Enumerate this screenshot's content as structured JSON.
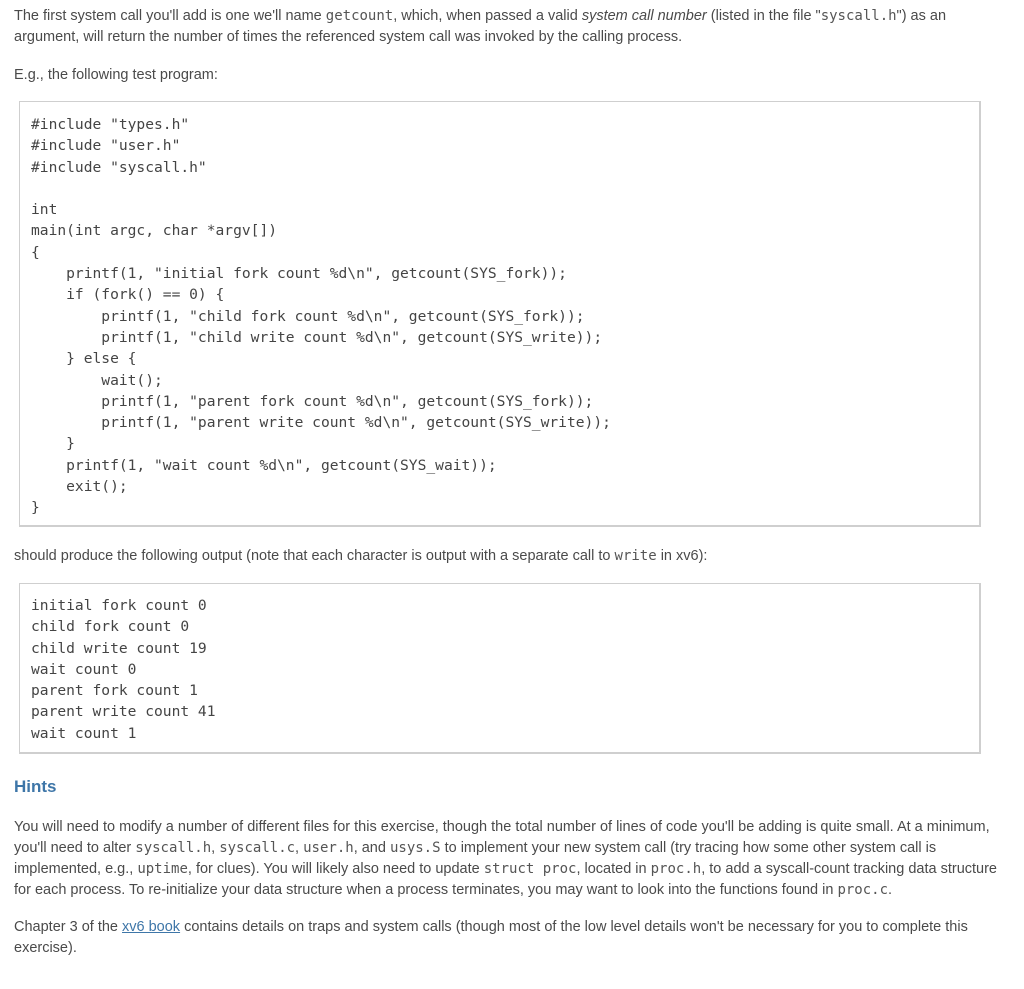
{
  "intro": {
    "part1": "The first system call you'll add is one we'll name ",
    "code_getcount": "getcount",
    "part2": ", which, when passed a valid ",
    "em_syscall_number": "system call number",
    "part3": " (listed in the file \"",
    "code_syscall_h": "syscall.h",
    "part4": "\") as an argument, will return the number of times the referenced system call was invoked by the calling process."
  },
  "example_intro": "E.g., the following test program:",
  "test_program_code": "#include \"types.h\"\n#include \"user.h\"\n#include \"syscall.h\"\n\nint\nmain(int argc, char *argv[])\n{\n    printf(1, \"initial fork count %d\\n\", getcount(SYS_fork));\n    if (fork() == 0) {\n        printf(1, \"child fork count %d\\n\", getcount(SYS_fork));\n        printf(1, \"child write count %d\\n\", getcount(SYS_write));\n    } else {\n        wait();\n        printf(1, \"parent fork count %d\\n\", getcount(SYS_fork));\n        printf(1, \"parent write count %d\\n\", getcount(SYS_write));\n    }\n    printf(1, \"wait count %d\\n\", getcount(SYS_wait));\n    exit();\n}",
  "output_intro": {
    "part1": "should produce the following output (note that each character is output with a separate call to ",
    "code_write": "write",
    "part2": " in xv6):"
  },
  "expected_output": "initial fork count 0\nchild fork count 0\nchild write count 19\nwait count 0\nparent fork count 1\nparent write count 41\nwait count 1",
  "hints": {
    "heading": "Hints",
    "para1": {
      "t1": "You will need to modify a number of different files for this exercise, though the total number of lines of code you'll be adding is quite small. At a minimum, you'll need to alter ",
      "c1": "syscall.h",
      "t2": ", ",
      "c2": "syscall.c",
      "t3": ", ",
      "c3": "user.h",
      "t4": ", and ",
      "c4": "usys.S",
      "t5": " to implement your new system call (try tracing how some other system call is implemented, e.g., ",
      "c5": "uptime",
      "t6": ", for clues). You will likely also need to update ",
      "c6": "struct proc",
      "t7": ", located in ",
      "c7": "proc.h",
      "t8": ", to add a syscall-count tracking data structure for each process. To re-initialize your data structure when a process terminates, you may want to look into the functions found in ",
      "c8": "proc.c",
      "t9": "."
    },
    "para2": {
      "t1": "Chapter 3 of the ",
      "link": "xv6 book",
      "t2": " contains details on traps and system calls (though most of the low level details won't be necessary for you to complete this exercise)."
    }
  }
}
